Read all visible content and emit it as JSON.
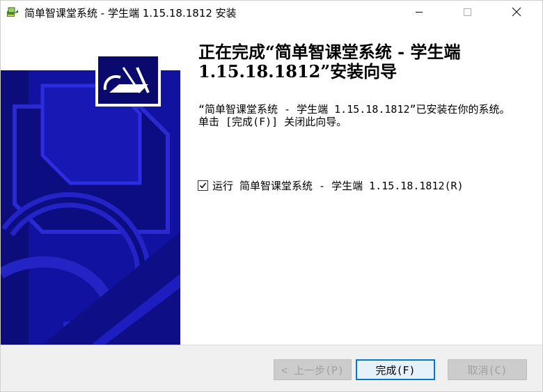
{
  "window": {
    "title": "简单智课堂系统 - 学生端 1.15.18.1812 安装",
    "icon": "installer-icon",
    "controls": [
      "minimize-icon",
      "maximize-icon",
      "close-icon"
    ]
  },
  "content": {
    "heading": "正在完成“简单智课堂系统 - 学生端 1.15.18.1812”安装向导",
    "message_line1": "“简单智课堂系统 - 学生端 1.15.18.1812”已安装在你的系统。",
    "message_line2": "单击 [完成(F)] 关闭此向导。",
    "run_checkbox": {
      "label": "运行 简单智课堂系统 - 学生端 1.15.18.1812(R)",
      "checked": true
    }
  },
  "buttons": {
    "back": "< 上一步(P)",
    "finish": "完成(F)",
    "cancel": "取消(C)"
  },
  "colors": {
    "banner_blue": "#1515a0",
    "banner_dark": "#0a0a6e",
    "focus_blue": "#0078d7"
  }
}
